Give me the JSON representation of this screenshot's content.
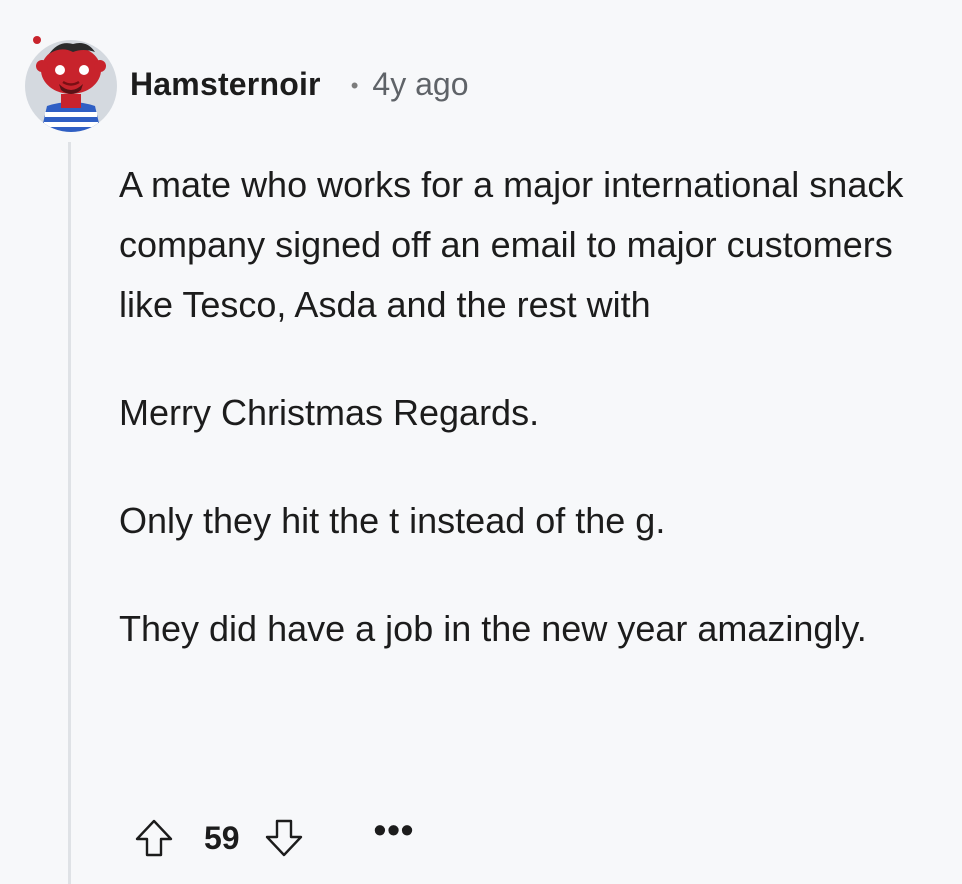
{
  "comment": {
    "author": "Hamsternoir",
    "separator": "•",
    "age": "4y ago",
    "paragraphs": [
      "A mate who works for a major international snack company signed off an email to major customers like Tesco, Asda and the rest with",
      "Merry Christmas Regards.",
      "Only they hit the t instead of the g.",
      "They did have a job in the new year amazingly."
    ],
    "score": "59",
    "more_label": "•••",
    "icons": {
      "upvote": "arrow-up-outline-icon",
      "downvote": "arrow-down-outline-icon",
      "more": "ellipsis-icon",
      "avatar": "snoo-avatar"
    },
    "colors": {
      "background": "#f7f8fa",
      "avatar_bg": "#d4d9df",
      "avatar_body": "#c8232c",
      "thread_line": "#dfe2e6",
      "text": "#1c1c1c",
      "muted": "#5f6368"
    }
  }
}
